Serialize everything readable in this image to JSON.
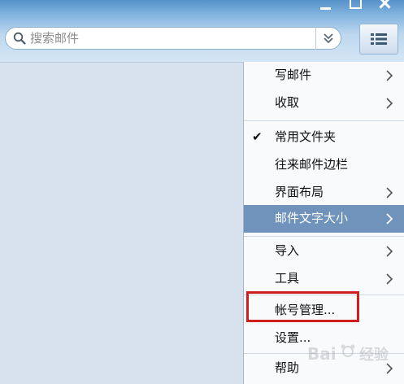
{
  "search": {
    "placeholder": "搜索邮件"
  },
  "menu": {
    "items": [
      {
        "label": "写邮件"
      },
      {
        "label": "收取"
      },
      {
        "label": "常用文件夹"
      },
      {
        "label": "往来邮件边栏"
      },
      {
        "label": "界面布局"
      },
      {
        "label": "邮件文字大小"
      },
      {
        "label": "导入"
      },
      {
        "label": "工具"
      },
      {
        "label": "帐号管理..."
      },
      {
        "label": "设置..."
      },
      {
        "label": "帮助"
      }
    ],
    "checked_item": "常用文件夹",
    "highlighted_item": "邮件文字大小",
    "check_mark": "✔"
  },
  "watermark": {
    "text": "Bai 经验"
  },
  "colors": {
    "title_gradient_top": "#5591c8",
    "menu_highlight": "#6f93bb",
    "callout_red": "#d01d1d",
    "content_bg": "#d7e2ee"
  }
}
